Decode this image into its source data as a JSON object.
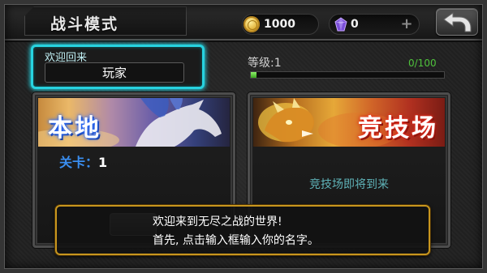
{
  "header": {
    "title": "战斗模式",
    "coins": "1000",
    "gems": "0",
    "add_gems_label": "+"
  },
  "welcome": {
    "label": "欢迎回来",
    "player_name": "玩家"
  },
  "level": {
    "label": "等级:1",
    "progress_text": "0/100",
    "progress_fill_fraction": 0.03
  },
  "modes": {
    "local": {
      "title": "本地",
      "stage_label": "关卡：",
      "stage_value": "1"
    },
    "arena": {
      "title": "竞技场",
      "status": "竞技场即将到来"
    }
  },
  "dialog": {
    "line1": "欢迎来到无尽之战的世界!",
    "line2": "首先, 点击输入框输入你的名字。"
  },
  "icons": {
    "coin": "coin-icon",
    "gem": "gem-icon",
    "add": "plus-icon",
    "back": "back-arrow-icon"
  },
  "colors": {
    "welcome_glow": "#27d3e0",
    "progress_green": "#4fc23c",
    "stage_blue": "#3a8ef0",
    "arena_status": "#5fb3b8",
    "dialog_border": "#c8961e"
  }
}
